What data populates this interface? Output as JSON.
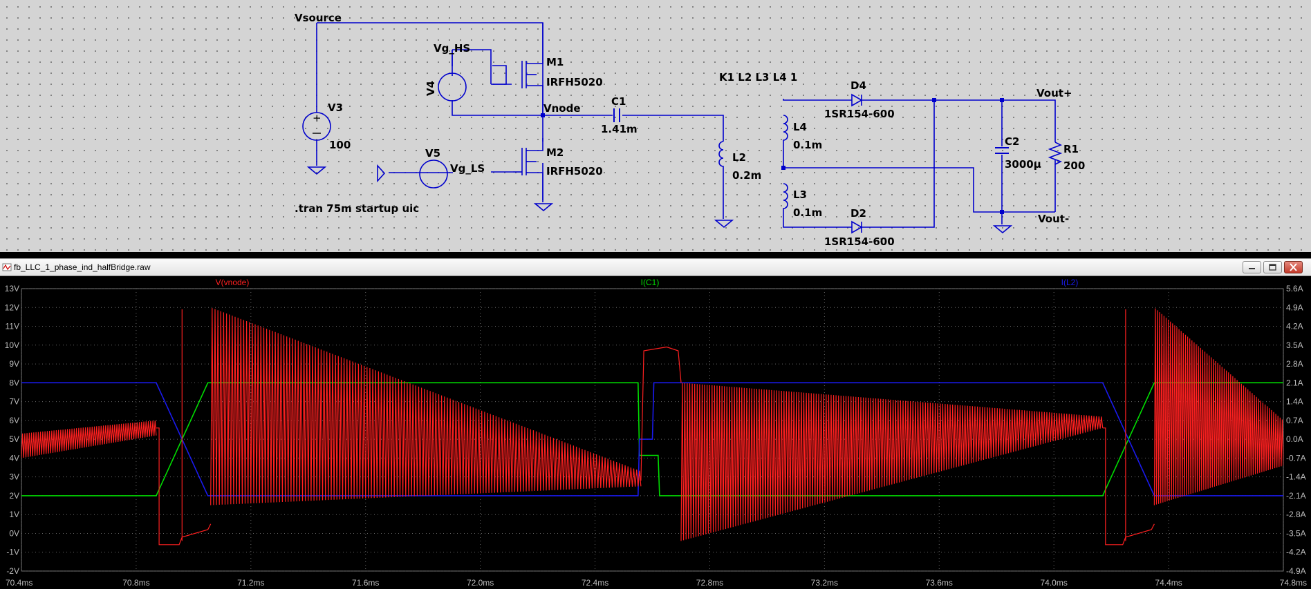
{
  "schematic": {
    "nets": {
      "vsource": "Vsource",
      "vg_hs": "Vg_HS",
      "vnode": "Vnode",
      "vg_ls": "Vg_LS",
      "vout_p": "Vout+",
      "vout_n": "Vout-"
    },
    "components": {
      "v3": {
        "name": "V3",
        "value": "100"
      },
      "v4": {
        "name": "V4"
      },
      "v5": {
        "name": "V5"
      },
      "m1": {
        "name": "M1",
        "value": "IRFH5020"
      },
      "m2": {
        "name": "M2",
        "value": "IRFH5020"
      },
      "c1": {
        "name": "C1",
        "value": "1.41m"
      },
      "l2": {
        "name": "L2",
        "value": "0.2m"
      },
      "l4": {
        "name": "L4",
        "value": "0.1m"
      },
      "l3": {
        "name": "L3",
        "value": "0.1m"
      },
      "d4": {
        "name": "D4",
        "value": "1SR154-600"
      },
      "d2": {
        "name": "D2",
        "value": "1SR154-600"
      },
      "c2": {
        "name": "C2",
        "value": "3000µ"
      },
      "r1": {
        "name": "R1",
        "value": "200"
      }
    },
    "directives": {
      "coupling": "K1 L2 L3 L4 1",
      "tran": ".tran 75m startup uic"
    }
  },
  "window": {
    "title": "fb_LLC_1_phase_ind_halfBridge.raw"
  },
  "chart_data": {
    "type": "line",
    "x_unit": "ms",
    "xlim": [
      70.4,
      74.8
    ],
    "x_ticks": [
      "70.4ms",
      "70.8ms",
      "71.2ms",
      "71.6ms",
      "72.0ms",
      "72.4ms",
      "72.8ms",
      "73.2ms",
      "73.6ms",
      "74.0ms",
      "74.4ms",
      "74.8ms"
    ],
    "y_left": {
      "lim": [
        -2,
        13
      ],
      "ticks": [
        "13V",
        "12V",
        "11V",
        "10V",
        "9V",
        "8V",
        "7V",
        "6V",
        "5V",
        "4V",
        "3V",
        "2V",
        "1V",
        "0V",
        "-1V",
        "-2V"
      ]
    },
    "y_right": {
      "lim": [
        -4.9,
        5.6
      ],
      "ticks": [
        "5.6A",
        "4.9A",
        "4.2A",
        "3.5A",
        "2.8A",
        "2.1A",
        "1.4A",
        "0.7A",
        "0.0A",
        "-0.7A",
        "-1.4A",
        "-2.1A",
        "-2.8A",
        "-3.5A",
        "-4.2A",
        "-4.9A"
      ]
    },
    "series": [
      {
        "name": "V(vnode)",
        "color": "#ff2020",
        "axis": "left",
        "segments": [
          {
            "kind": "ramp",
            "x": [
              70.4,
              70.87
            ],
            "lo": [
              4.0,
              5.2
            ],
            "hi": [
              5.3,
              6.0
            ],
            "cycles": 60
          },
          {
            "kind": "step",
            "x": [
              70.87,
              70.88,
              70.88,
              70.95,
              70.96,
              71.05,
              71.06
            ],
            "y": [
              5.6,
              5.6,
              -0.6,
              -0.6,
              -0.2,
              0.2,
              0.5
            ]
          },
          {
            "kind": "spike",
            "x": 70.96,
            "y": [
              -0.4,
              11.9
            ]
          },
          {
            "kind": "ramp",
            "x": [
              71.06,
              72.56
            ],
            "lo": [
              1.5,
              2.5
            ],
            "hi": [
              12.0,
              3.3
            ],
            "cycles": 150
          },
          {
            "kind": "step",
            "x": [
              72.56,
              72.57,
              72.65,
              72.69,
              72.7
            ],
            "y": [
              2.8,
              9.7,
              9.9,
              9.7,
              8.0
            ]
          },
          {
            "kind": "ramp",
            "x": [
              72.7,
              74.17
            ],
            "lo": [
              -0.4,
              5.6
            ],
            "hi": [
              8.0,
              6.2
            ],
            "cycles": 170
          },
          {
            "kind": "step",
            "x": [
              74.17,
              74.18,
              74.18,
              74.24,
              74.25,
              74.34,
              74.35
            ],
            "y": [
              5.6,
              5.6,
              -0.6,
              -0.6,
              -0.2,
              0.2,
              0.5
            ]
          },
          {
            "kind": "spike",
            "x": 74.25,
            "y": [
              -0.4,
              11.9
            ]
          },
          {
            "kind": "ramp",
            "x": [
              74.35,
              74.8
            ],
            "lo": [
              1.5,
              3.6
            ],
            "hi": [
              12.0,
              6.0
            ],
            "cycles": 60
          }
        ]
      },
      {
        "name": "I(C1)",
        "color": "#00dd00",
        "axis": "right",
        "points": [
          [
            70.4,
            -2.1
          ],
          [
            70.87,
            -2.1
          ],
          [
            71.05,
            2.1
          ],
          [
            72.55,
            2.1
          ],
          [
            72.555,
            -0.6
          ],
          [
            72.62,
            -0.6
          ],
          [
            72.625,
            -2.1
          ],
          [
            74.17,
            -2.1
          ],
          [
            74.35,
            2.1
          ],
          [
            74.8,
            2.1
          ]
        ]
      },
      {
        "name": "I(L2)",
        "color": "#1a1aee",
        "axis": "right",
        "points": [
          [
            70.4,
            2.1
          ],
          [
            70.87,
            2.1
          ],
          [
            71.05,
            -2.1
          ],
          [
            72.55,
            -2.1
          ],
          [
            72.555,
            0.0
          ],
          [
            72.6,
            0.0
          ],
          [
            72.605,
            2.1
          ],
          [
            74.17,
            2.1
          ],
          [
            74.35,
            -2.1
          ],
          [
            74.8,
            -2.1
          ]
        ]
      }
    ]
  },
  "colors": {
    "schematic_bg": "#d4d4d4",
    "wire": "#0000cc",
    "plot_bg": "#000000",
    "grid": "#6a6a6a"
  }
}
